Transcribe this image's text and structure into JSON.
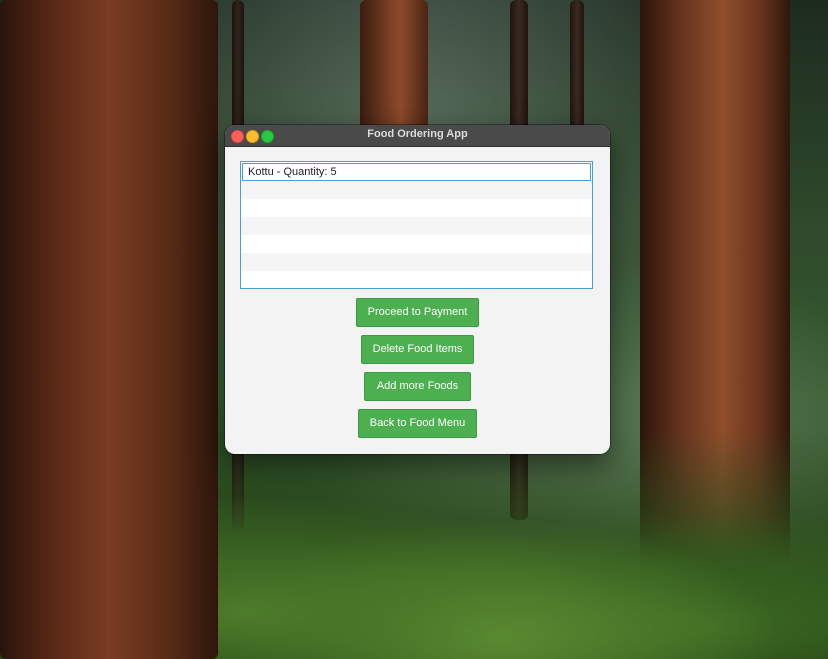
{
  "window": {
    "title": "Food Ordering App"
  },
  "order_list": {
    "items": [
      "Kottu - Quantity: 5",
      "",
      "",
      "",
      "",
      "",
      ""
    ],
    "selected_index": 0
  },
  "buttons": {
    "proceed_payment": "Proceed to Payment",
    "delete_items": "Delete Food Items",
    "add_more": "Add more Foods",
    "back_to_menu": "Back to Food Menu"
  },
  "colors": {
    "button_green": "#4caf50",
    "selection_border": "#4a9fd6",
    "titlebar": "#4a4a4a"
  }
}
